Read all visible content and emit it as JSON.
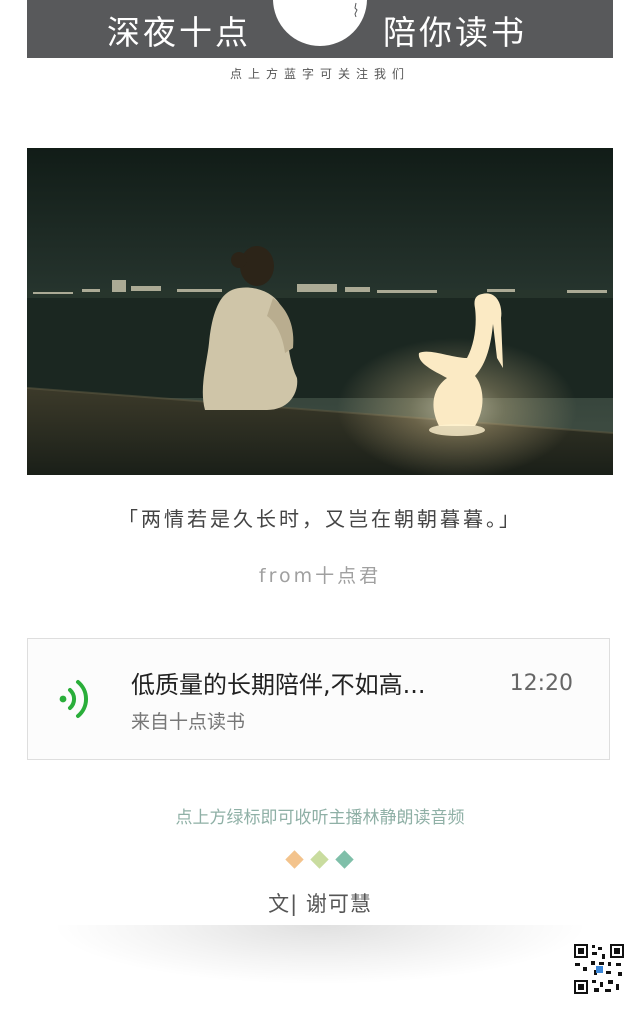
{
  "header": {
    "title_left": "深夜十点",
    "title_right": "陪你读书",
    "subscribe_hint": "点上方蓝字可关注我们"
  },
  "quote": {
    "text": "「两情若是久长时，又岂在朝朝暮暮。」",
    "source": "from十点君"
  },
  "audio": {
    "title": "低质量的长期陪伴,不如高...",
    "from": "来自十点读书",
    "duration": "12:20",
    "icon": "audio-wave-icon",
    "accent": "#2aae3a"
  },
  "listen_hint": "点上方绿标即可收听主播林静朗读音频",
  "divider_colors": [
    "#f3c38c",
    "#c9dc9f",
    "#7fbfa9"
  ],
  "author": "文|  谢可慧"
}
